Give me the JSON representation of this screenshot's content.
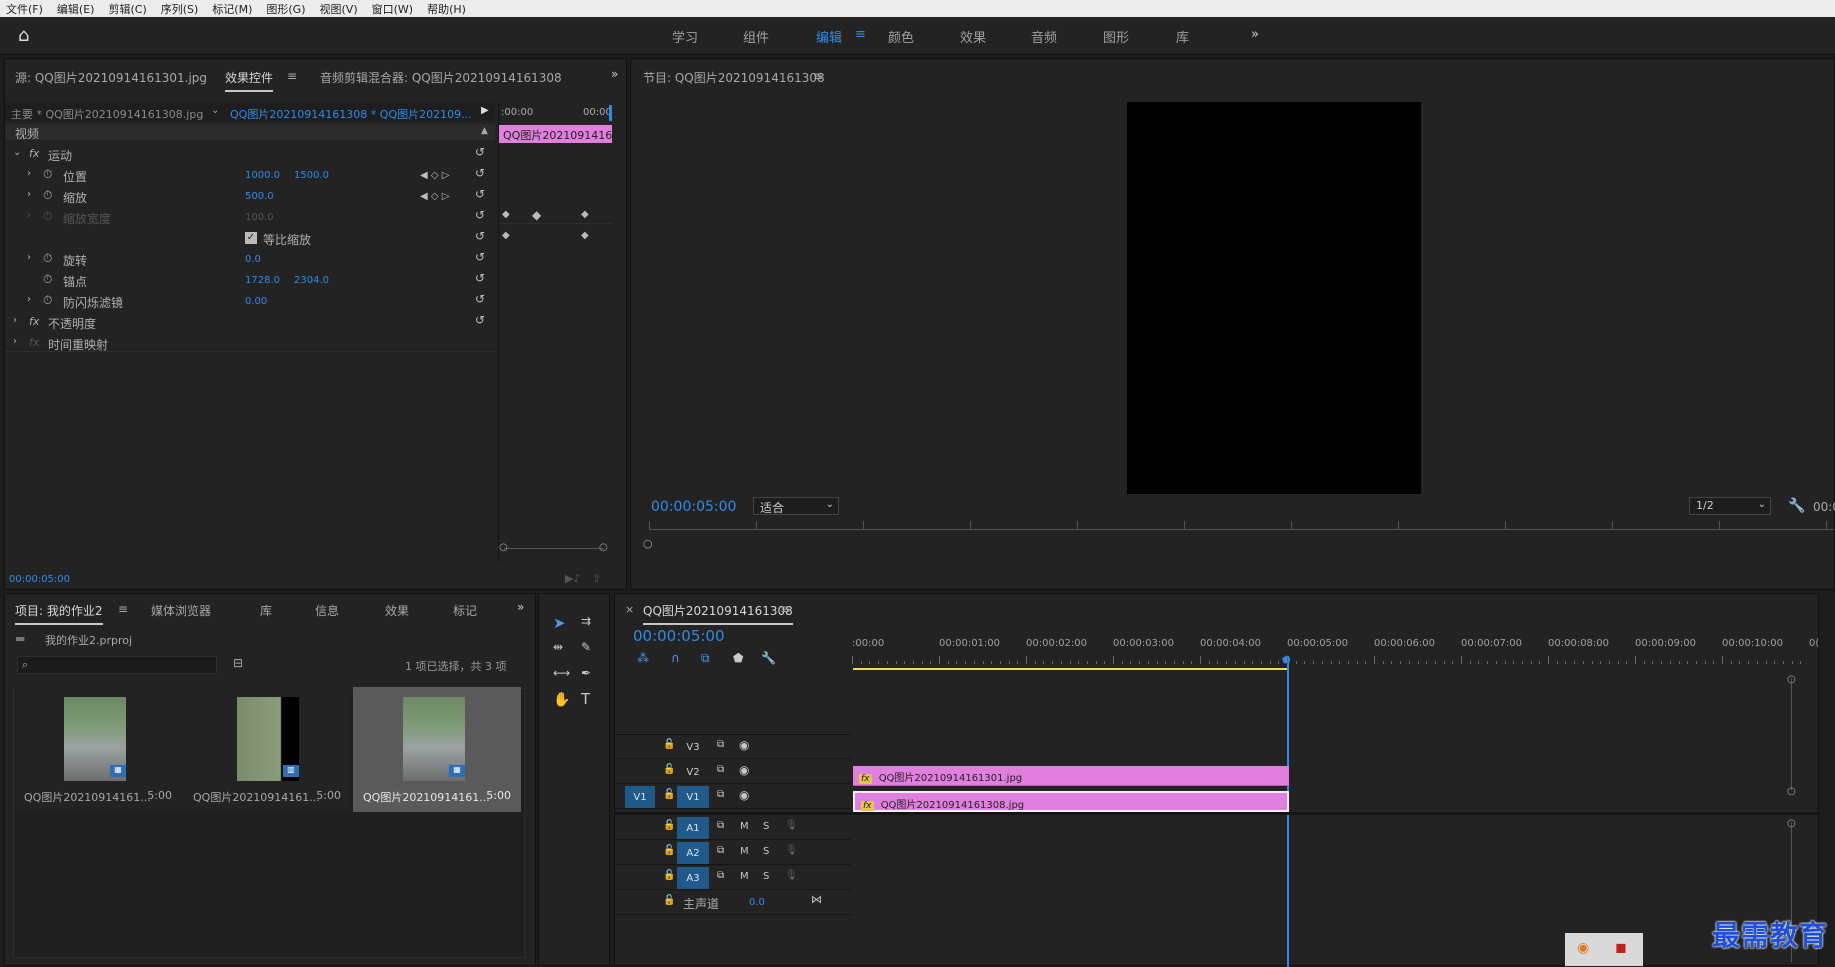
{
  "menu": [
    "文件(F)",
    "编辑(E)",
    "剪辑(C)",
    "序列(S)",
    "标记(M)",
    "图形(G)",
    "视图(V)",
    "窗口(W)",
    "帮助(H)"
  ],
  "workspaces": [
    "学习",
    "组件",
    "编辑",
    "颜色",
    "效果",
    "音频",
    "图形",
    "库"
  ],
  "workspace_active": "编辑",
  "source_panel": {
    "tab_source": "源: QQ图片20210914161301.jpg",
    "tab_effects": "效果控件",
    "tab_audio_mixer": "音频剪辑混合器: QQ图片20210914161308",
    "master_label": "主要 * QQ图片20210914161308.jpg",
    "clip_label": "QQ图片20210914161308 * QQ图片202109...",
    "time_start": ":00:00",
    "time_end": "00:00",
    "clip_bar": "QQ图片2021091416",
    "video_header": "视频",
    "motion": "运动",
    "position_label": "位置",
    "position_x": "1000.0",
    "position_y": "1500.0",
    "scale_label": "缩放",
    "scale_val": "500.0",
    "scale_width_label": "缩放宽度",
    "scale_width_val": "100.0",
    "uniform_scale": "等比缩放",
    "rotation_label": "旋转",
    "rotation_val": "0.0",
    "anchor_label": "锚点",
    "anchor_x": "1728.0",
    "anchor_y": "2304.0",
    "flicker_label": "防闪烁滤镜",
    "flicker_val": "0.00",
    "opacity": "不透明度",
    "time_remap": "时间重映射",
    "timecode": "00:00:05:00"
  },
  "program": {
    "title": "节目: QQ图片20210914161308",
    "timecode": "00:00:05:00",
    "fit": "适合",
    "resolution": "1/2",
    "tc_right": "00:0"
  },
  "project": {
    "tabs": [
      "项目: 我的作业2",
      "媒体浏览器",
      "库",
      "信息",
      "效果",
      "标记"
    ],
    "file": "我的作业2.prproj",
    "selection": "1 项已选择，共 3 项",
    "items": [
      {
        "name": "QQ图片20210914161...",
        "dur": "5:00"
      },
      {
        "name": "QQ图片20210914161...",
        "dur": "5:00"
      },
      {
        "name": "QQ图片20210914161...",
        "dur": "5:00"
      }
    ]
  },
  "timeline": {
    "title": "QQ图片20210914161308",
    "timecode": "00:00:05:00",
    "ruler": [
      ":00:00",
      "00:00:01:00",
      "00:00:02:00",
      "00:00:03:00",
      "00:00:04:00",
      "00:00:05:00",
      "00:00:06:00",
      "00:00:07:00",
      "00:00:08:00",
      "00:00:09:00",
      "00:00:10:00",
      "0("
    ],
    "video_tracks": [
      "V3",
      "V2",
      "V1"
    ],
    "audio_tracks": [
      "A1",
      "A2",
      "A3"
    ],
    "source_patch": "V1",
    "mute": "M",
    "solo": "S",
    "master": "主声道",
    "master_val": "0.0",
    "clip_v2": "QQ图片20210914161301.jpg",
    "clip_v1": "QQ图片20210914161308.jpg",
    "fx": "fx"
  },
  "watermark": "最需教育",
  "colors": {
    "accent": "#2d8ceb",
    "clip": "#e07fdd",
    "playhead": "#2d8ceb",
    "workarea": "#e8e04a"
  }
}
